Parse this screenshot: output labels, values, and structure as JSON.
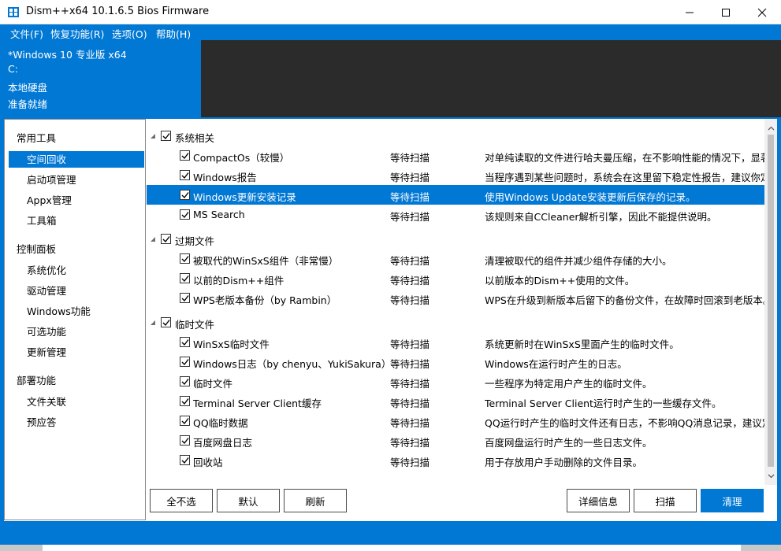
{
  "window": {
    "title": "Dism++x64 10.1.6.5 Bios Firmware",
    "icons": {
      "minimize": "minimize-icon",
      "maximize": "maximize-icon",
      "close": "close-icon"
    }
  },
  "menu": {
    "file": "文件(F)",
    "restore": "恢复功能(R)",
    "options": "选项(O)",
    "help": "帮助(H)"
  },
  "info": {
    "os": "*Windows 10 专业版 x64",
    "drive": "C:",
    "disk_type": "本地硬盘",
    "status": "准备就绪"
  },
  "sidebar": {
    "groups": [
      {
        "label": "常用工具",
        "items": [
          "空间回收",
          "启动项管理",
          "Appx管理",
          "工具箱"
        ]
      },
      {
        "label": "控制面板",
        "items": [
          "系统优化",
          "驱动管理",
          "Windows功能",
          "可选功能",
          "更新管理"
        ]
      },
      {
        "label": "部署功能",
        "items": [
          "文件关联",
          "预应答"
        ]
      }
    ],
    "active": "空间回收"
  },
  "tree": {
    "groups": [
      {
        "label": "系统相关",
        "checked": true,
        "items": [
          {
            "name": "CompactOs（较慢）",
            "status": "等待扫描",
            "desc": "对单纯读取的文件进行哈夫曼压缩，在不影响性能的情况下，显著减",
            "checked": true
          },
          {
            "name": "Windows报告",
            "status": "等待扫描",
            "desc": "当程序遇到某些问题时，系统会在这里留下稳定性报告，建议你定期",
            "checked": true
          },
          {
            "name": "Windows更新安装记录",
            "status": "等待扫描",
            "desc": "使用Windows Update安装更新后保存的记录。",
            "checked": true,
            "selected": true
          },
          {
            "name": "MS Search",
            "status": "等待扫描",
            "desc": "该规则来自CCleaner解析引擎，因此不能提供说明。",
            "checked": true
          }
        ]
      },
      {
        "label": "过期文件",
        "checked": true,
        "items": [
          {
            "name": "被取代的WinSxS组件（非常慢）",
            "status": "等待扫描",
            "desc": "清理被取代的组件并减少组件存储的大小。",
            "checked": true
          },
          {
            "name": "以前的Dism++组件",
            "status": "等待扫描",
            "desc": "以前版本的Dism++使用的文件。",
            "checked": true
          },
          {
            "name": "WPS老版本备份（by Rambin）",
            "status": "等待扫描",
            "desc": "WPS在升级到新版本后留下的备份文件，在故障时回滚到老版本。",
            "checked": true
          }
        ]
      },
      {
        "label": "临时文件",
        "checked": true,
        "items": [
          {
            "name": "WinSxS临时文件",
            "status": "等待扫描",
            "desc": "系统更新时在WinSxS里面产生的临时文件。",
            "checked": true
          },
          {
            "name": "Windows日志（by chenyu、YukiSakura）",
            "status": "等待扫描",
            "desc": "Windows在运行时产生的日志。",
            "checked": true
          },
          {
            "name": "临时文件",
            "status": "等待扫描",
            "desc": "一些程序为特定用户产生的临时文件。",
            "checked": true
          },
          {
            "name": "Terminal Server Client缓存",
            "status": "等待扫描",
            "desc": "Terminal Server Client运行时产生的一些缓存文件。",
            "checked": true
          },
          {
            "name": "QQ临时数据",
            "status": "等待扫描",
            "desc": "QQ运行时产生的临时文件还有日志，不影响QQ消息记录，建议定期",
            "checked": true
          },
          {
            "name": "百度网盘日志",
            "status": "等待扫描",
            "desc": "百度网盘运行时产生的一些日志文件。",
            "checked": true
          },
          {
            "name": "回收站",
            "status": "等待扫描",
            "desc": "用于存放用户手动删除的文件目录。",
            "checked": true
          }
        ]
      }
    ]
  },
  "buttons": {
    "select_none": "全不选",
    "default": "默认",
    "refresh": "刷新",
    "details": "详细信息",
    "scan": "扫描",
    "clean": "清理"
  },
  "colors": {
    "accent": "#0178d4",
    "dark_panel": "#2b2b2b"
  }
}
